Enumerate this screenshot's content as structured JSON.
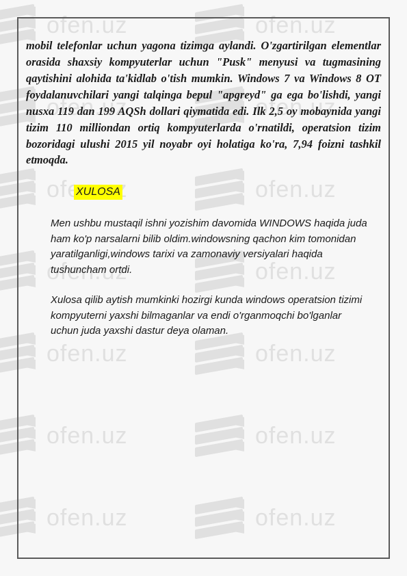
{
  "watermark_text": "ofen.uz",
  "document": {
    "paragraph_main": "mobil telefonlar uchun yagona tizimga aylandi. O'zgartirilgan elementlar orasida shaxsiy kompyuterlar uchun \"Pusk\" menyusi va tugmasining qaytishini alohida ta'kidlab o'tish mumkin. Windows 7 va Windows 8 OT foydalanuvchilari yangi talqinga bepul \"apgreyd\" ga ega bo'lishdi, yangi nusxa 119 dan 199 AQSh dollari qiymatida edi. Ilk 2,5 oy mobaynida yangi tizim 110 milliondan ortiq kompyuterlarda o'rnatildi, operatsion tizim bozoridagi ulushi 2015 yil noyabr oyi holatiga ko'ra, 7,94 foizni tashkil etmoqda.",
    "heading_xulosa": "XULOSA",
    "paragraph_body_1": "Men ushbu  mustaqil ishni yozishim davomida WINDOWS haqida juda ham ko'p narsalarni bilib oldim.windowsning qachon kim tomonidan yaratilganligi,windows tarixi va zamonaviy versiyalari haqida tushuncham ortdi.",
    "paragraph_body_2": "Xulosa qilib aytish mumkinki hozirgi kunda windows operatsion tizimi kompyuterni yaxshi bilmaganlar va endi o'rganmoqchi bo'lganlar uchun juda yaxshi dastur deya olaman."
  }
}
